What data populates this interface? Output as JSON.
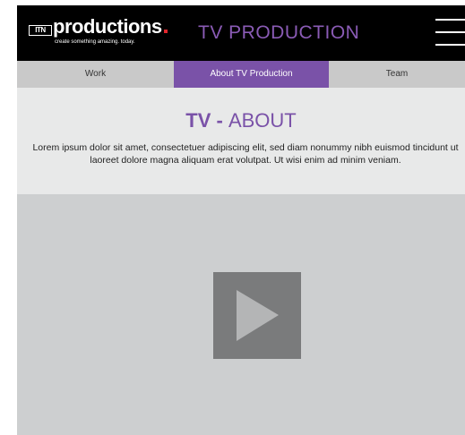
{
  "header": {
    "logo_badge": "ITN",
    "logo_word": "productions",
    "logo_tagline": "create something amazing. today.",
    "title": "TV PRODUCTION",
    "menu_icon": "hamburger-menu-icon"
  },
  "nav": {
    "tabs": [
      {
        "label": "Work",
        "active": false
      },
      {
        "label": "About TV Production",
        "active": true
      },
      {
        "label": "Team",
        "active": false
      }
    ]
  },
  "about": {
    "heading_bold": "TV",
    "heading_sep": " - ",
    "heading_rest": "ABOUT",
    "body": "Lorem ipsum dolor sit amet, consectetuer adipiscing elit, sed diam nonummy nibh euismod tincidunt ut laoreet dolore magna aliquam erat volutpat. Ut wisi enim ad minim veniam."
  },
  "video": {
    "play_icon": "play-icon"
  },
  "colors": {
    "accent": "#7a52a8",
    "header_bg": "#000000",
    "nav_bg": "#c9c9c9",
    "about_bg": "#e8e9e9",
    "video_bg": "#cdcfd0",
    "play_bg": "#7a7b7c"
  }
}
